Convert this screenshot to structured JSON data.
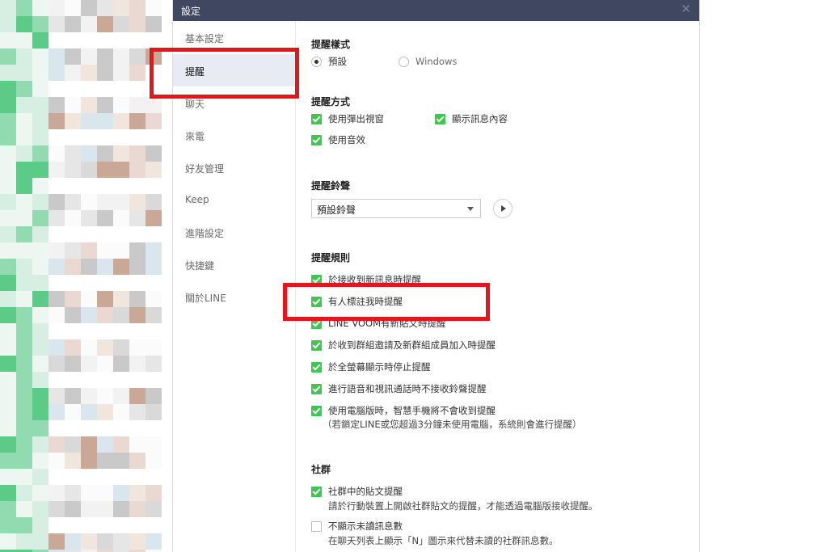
{
  "window": {
    "title": "設定",
    "close_icon": "close-icon"
  },
  "sidebar": {
    "items": [
      {
        "label": "基本設定"
      },
      {
        "label": "提醒",
        "active": true
      },
      {
        "label": "聊天"
      },
      {
        "label": "來電"
      },
      {
        "label": "好友管理"
      },
      {
        "label": "Keep"
      },
      {
        "label": "進階設定"
      },
      {
        "label": "快捷鍵"
      },
      {
        "label": "關於LINE"
      }
    ]
  },
  "notification_style": {
    "title": "提醒樣式",
    "options": [
      {
        "label": "預設",
        "selected": true
      },
      {
        "label": "Windows",
        "selected": false
      }
    ]
  },
  "notification_method": {
    "title": "提醒方式",
    "options": [
      {
        "label": "使用彈出視窗",
        "checked": true
      },
      {
        "label": "顯示訊息內容",
        "checked": true
      },
      {
        "label": "使用音效",
        "checked": true
      }
    ]
  },
  "ringtone": {
    "title": "提醒鈴聲",
    "value": "預設鈴聲",
    "play_icon": "play-icon",
    "dropdown_icon": "chevron-down-icon"
  },
  "rules": {
    "title": "提醒規則",
    "items": [
      {
        "label": "於接收到新訊息時提醒",
        "checked": true
      },
      {
        "label": "有人標註我時提醒",
        "checked": true
      },
      {
        "label": "LINE VOOM有新貼文時提醒",
        "checked": true
      },
      {
        "label": "於收到群組邀請及新群組成員加入時提醒",
        "checked": true
      },
      {
        "label": "於全螢幕顯示時停止提醒",
        "checked": true
      },
      {
        "label": "進行語音和視訊通話時不接收鈴聲提醒",
        "checked": true
      },
      {
        "label": "使用電腦版時，智慧手機將不會收到提醒",
        "checked": true,
        "note": "（若鎖定LINE或您超過3分鐘未使用電腦，系統則會進行提醒）"
      }
    ]
  },
  "community": {
    "title": "社群",
    "items": [
      {
        "label": "社群中的貼文提醒",
        "checked": true,
        "note": "請於行動裝置上開啟社群貼文的提醒，才能透過電腦版接收提醒。"
      },
      {
        "label": "不顯示未讀訊息數",
        "checked": false,
        "note": "在聊天列表上顯示「N」圖示來代替未讀的社群訊息數。"
      }
    ]
  },
  "colors": {
    "titlebar": "#404760",
    "checkbox": "#3fc650",
    "highlight": "#e8141b",
    "active_nav": "#e8ebf2"
  }
}
